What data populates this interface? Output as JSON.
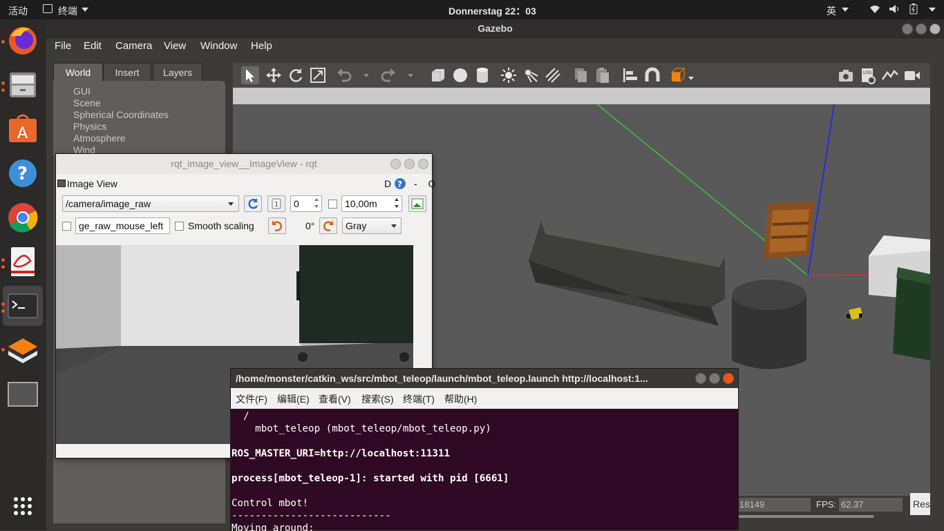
{
  "topbar": {
    "activities": "活动",
    "app_name": "终端",
    "clock": "Donnerstag 22：03",
    "input_method": "英"
  },
  "gazebo": {
    "title": "Gazebo",
    "menu": [
      "File",
      "Edit",
      "Camera",
      "View",
      "Window",
      "Help"
    ],
    "tabs": [
      "World",
      "Insert",
      "Layers"
    ],
    "world_items": [
      "GUI",
      "Scene",
      "Spherical Coordinates",
      "Physics",
      "Atmosphere",
      "Wind"
    ],
    "status": {
      "time_value": "18149",
      "fps_label": "FPS:",
      "fps_value": "62.37",
      "reset_label": "Res"
    }
  },
  "rqt": {
    "title": "rqt_image_view__ImageView - rqt",
    "plugin_title": "Image View",
    "plugin_controls": "D",
    "plugin_minmax": "- O",
    "topic": "/camera/image_raw",
    "value_field": "0",
    "max_range": "10,00m",
    "mouse_topic": "ge_raw_mouse_left",
    "smooth_scaling_label": "Smooth scaling",
    "rotation": "0°",
    "color_scheme": "Gray"
  },
  "terminal": {
    "title": "/home/monster/catkin_ws/src/mbot_teleop/launch/mbot_teleop.launch http://localhost:1...",
    "menu": [
      "文件(F)",
      "编辑(E)",
      "查看(V)",
      "搜索(S)",
      "终端(T)",
      "帮助(H)"
    ],
    "lines": [
      {
        "text": "  /",
        "bold": false
      },
      {
        "text": "    mbot_teleop (mbot_teleop/mbot_teleop.py)",
        "bold": false
      },
      {
        "text": "",
        "bold": false
      },
      {
        "text": "ROS_MASTER_URI=http://localhost:11311",
        "bold": true
      },
      {
        "text": "",
        "bold": false
      },
      {
        "text": "process[mbot_teleop-1]: started with pid [6661]",
        "bold": true
      },
      {
        "text": "",
        "bold": false
      },
      {
        "text": "Control mbot!",
        "bold": false
      },
      {
        "text": "---------------------------",
        "bold": false
      },
      {
        "text": "Moving around:",
        "bold": false
      }
    ]
  }
}
